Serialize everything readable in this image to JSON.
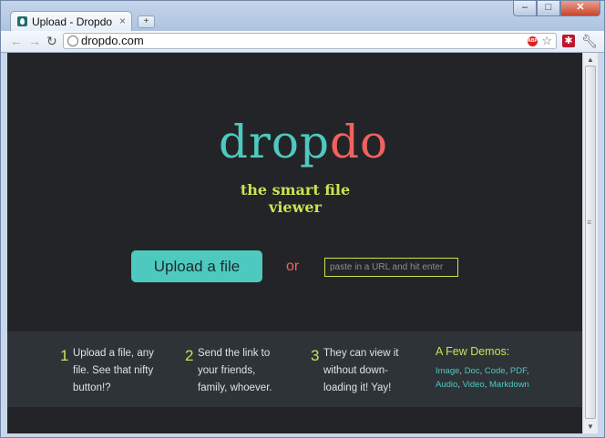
{
  "browser": {
    "tab_title": "Upload - Dropdo",
    "tab_close": "×",
    "new_tab": "+",
    "url": "dropdo.com",
    "abp_label": "ABP",
    "ext_label": "✱",
    "window_buttons": {
      "minimize": "–",
      "maximize": "□",
      "close": "✕"
    }
  },
  "page": {
    "logo": {
      "part1": "drop",
      "part2": "do"
    },
    "tagline": "the smart file viewer",
    "upload_button": "Upload a file",
    "or_label": "or",
    "url_input_placeholder": "paste in a URL and hit enter",
    "steps": [
      {
        "num": "1",
        "text": "Upload a file, any file. See that nifty button!?"
      },
      {
        "num": "2",
        "text": "Send the link to your friends, family, whoever."
      },
      {
        "num": "3",
        "text": "They can view it without down-loading it! Yay!"
      }
    ],
    "demos": {
      "title": "A Few Demos:",
      "links": [
        "Image",
        "Doc",
        "Code",
        "PDF",
        "Audio",
        "Video",
        "Markdown"
      ]
    }
  },
  "colors": {
    "teal": "#4ec9c0",
    "coral": "#f0625f",
    "lime": "#c6e553",
    "page_bg": "#232427"
  }
}
